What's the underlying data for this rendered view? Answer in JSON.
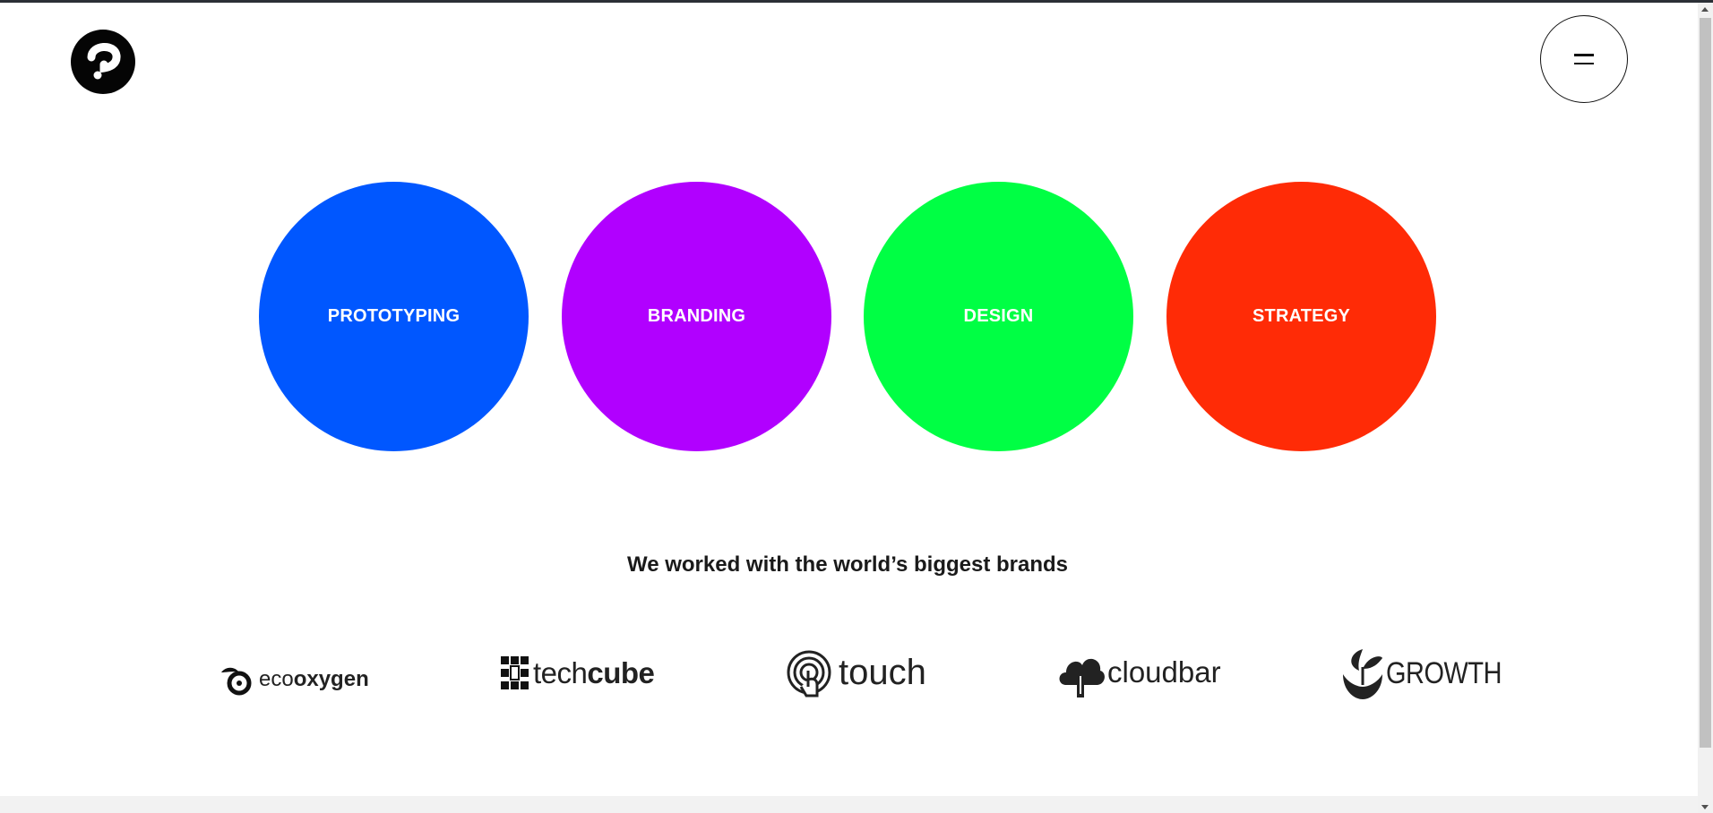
{
  "header": {
    "logo_icon": "p-logo-icon",
    "menu_icon": "menu-icon"
  },
  "services": [
    {
      "label": "PROTOTYPING",
      "color": "#0057ff"
    },
    {
      "label": "BRANDING",
      "color": "#b100ff"
    },
    {
      "label": "DESIGN",
      "color": "#00ff44"
    },
    {
      "label": "STRATEGY",
      "color": "#ff2b06"
    }
  ],
  "brands_section": {
    "heading": "We worked with the world’s biggest brands",
    "brands": [
      {
        "prefix": "eco",
        "main": "oxygen",
        "icon": "leaf-icon"
      },
      {
        "prefix": "tech",
        "main": "cube",
        "icon": "cube-grid-icon"
      },
      {
        "prefix": "",
        "main": "touch",
        "icon": "fingerprint-touch-icon"
      },
      {
        "prefix": "",
        "main": "cloudbar",
        "icon": "cloud-icon"
      },
      {
        "prefix": "",
        "main": "GROWTH",
        "icon": "sprout-icon"
      }
    ]
  }
}
